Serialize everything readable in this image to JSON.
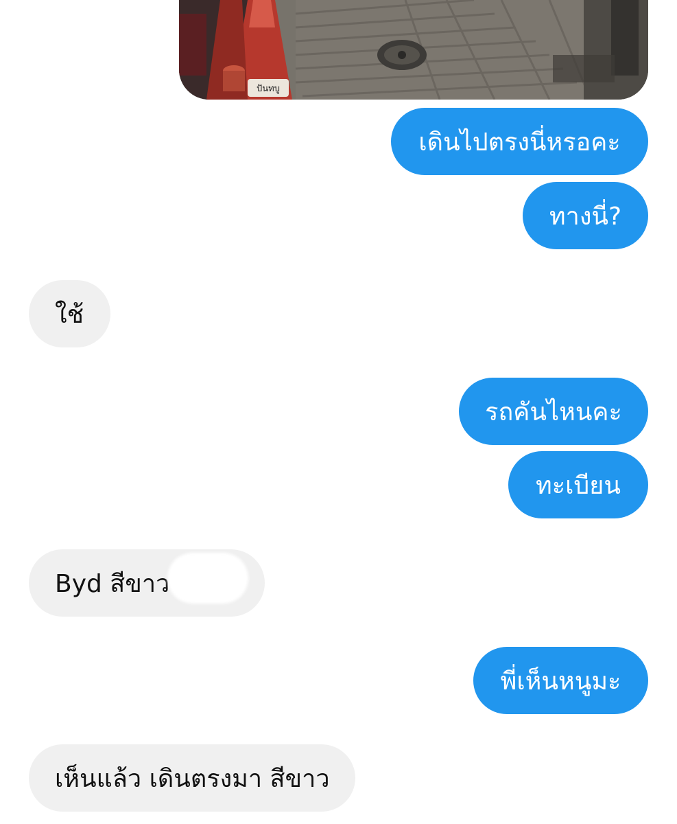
{
  "conversation": {
    "messages": [
      {
        "from": "me",
        "text": "เดินไปตรงนี่หรอคะ"
      },
      {
        "from": "me",
        "text": "ทางนี่?"
      },
      {
        "from": "them",
        "text": "ใช้"
      },
      {
        "from": "me",
        "text": "รถคันไหนคะ"
      },
      {
        "from": "me",
        "text": "ทะเบียน"
      },
      {
        "from": "them",
        "text": "Byd สีขาว "
      },
      {
        "from": "me",
        "text": "พี่เห็นหนูมะ"
      },
      {
        "from": "them",
        "text": "เห็นแล้ว เดินตรงมา สีขาว"
      }
    ]
  },
  "photo": {
    "cone_label": "ปันทบู"
  },
  "colors": {
    "outgoing_bubble": "#2196ee",
    "incoming_bubble": "#f0f0f0",
    "background": "#ffffff"
  }
}
